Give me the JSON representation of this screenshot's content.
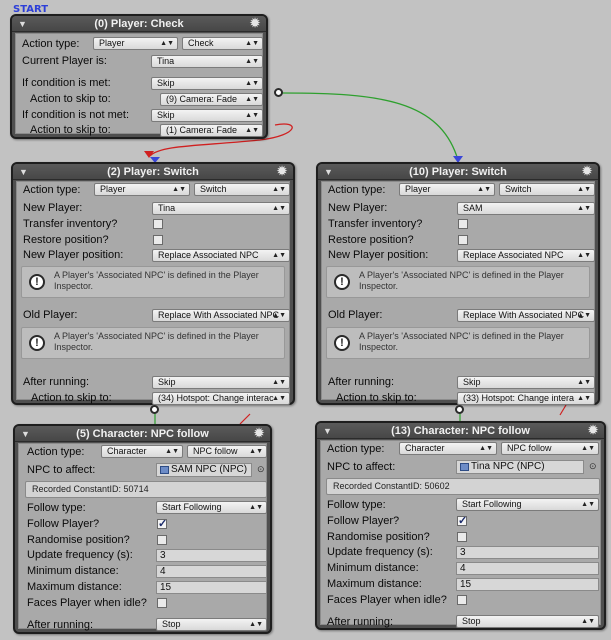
{
  "start_label": "START",
  "node0": {
    "title": "(0) Player: Check",
    "action_type_label": "Action type:",
    "action_type_value": "Player",
    "action_type_sub": "Check",
    "current_player_label": "Current Player is:",
    "current_player_value": "Tina",
    "if_met_label": "If condition is met:",
    "if_met_value": "Skip",
    "skip1_label": "Action to skip to:",
    "skip1_value": "(9) Camera: Fade",
    "if_not_met_label": "If condition is not met:",
    "if_not_met_value": "Skip",
    "skip2_label": "Action to skip to:",
    "skip2_value": "(1) Camera: Fade"
  },
  "node2": {
    "title": "(2) Player: Switch",
    "action_type_label": "Action type:",
    "action_type_value": "Player",
    "action_type_sub": "Switch",
    "new_player_label": "New Player:",
    "new_player_value": "Tina",
    "transfer_label": "Transfer inventory?",
    "restore_label": "Restore position?",
    "new_pos_label": "New Player position:",
    "new_pos_value": "Replace Associated NPC",
    "info1": "A Player's 'Associated NPC' is defined in the Player Inspector.",
    "old_player_label": "Old Player:",
    "old_player_value": "Replace With Associated NPC",
    "info2": "A Player's 'Associated NPC' is defined in the Player Inspector.",
    "after_label": "After running:",
    "after_value": "Skip",
    "skip_label": "Action to skip to:",
    "skip_value": "(34) Hotspot: Change interac"
  },
  "node10": {
    "title": "(10) Player: Switch",
    "action_type_label": "Action type:",
    "action_type_value": "Player",
    "action_type_sub": "Switch",
    "new_player_label": "New Player:",
    "new_player_value": "SAM",
    "transfer_label": "Transfer inventory?",
    "restore_label": "Restore position?",
    "new_pos_label": "New Player position:",
    "new_pos_value": "Replace Associated NPC",
    "info1": "A Player's 'Associated NPC' is defined in the Player Inspector.",
    "old_player_label": "Old Player:",
    "old_player_value": "Replace With Associated NPC",
    "info2": "A Player's 'Associated NPC' is defined in the Player Inspector.",
    "after_label": "After running:",
    "after_value": "Skip",
    "skip_label": "Action to skip to:",
    "skip_value": "(33) Hotspot: Change intera"
  },
  "node5": {
    "title": "(5) Character: NPC follow",
    "action_type_label": "Action type:",
    "action_type_value": "Character",
    "action_type_sub": "NPC follow",
    "npc_label": "NPC to affect:",
    "npc_value": "SAM NPC (NPC)",
    "recorded": "Recorded ConstantID: 50714",
    "follow_type_label": "Follow type:",
    "follow_type_value": "Start Following",
    "follow_player_label": "Follow Player?",
    "randomise_label": "Randomise position?",
    "update_label": "Update frequency (s):",
    "update_value": "3",
    "min_label": "Minimum distance:",
    "min_value": "4",
    "max_label": "Maximum distance:",
    "max_value": "15",
    "faces_label": "Faces Player when idle?",
    "after_label": "After running:",
    "after_value": "Stop"
  },
  "node13": {
    "title": "(13) Character: NPC follow",
    "action_type_label": "Action type:",
    "action_type_value": "Character",
    "action_type_sub": "NPC follow",
    "npc_label": "NPC to affect:",
    "npc_value": "Tina NPC (NPC)",
    "recorded": "Recorded ConstantID: 50602",
    "follow_type_label": "Follow type:",
    "follow_type_value": "Start Following",
    "follow_player_label": "Follow Player?",
    "randomise_label": "Randomise position?",
    "update_label": "Update frequency (s):",
    "update_value": "3",
    "min_label": "Minimum distance:",
    "min_value": "4",
    "max_label": "Maximum distance:",
    "max_value": "15",
    "faces_label": "Faces Player when idle?",
    "after_label": "After running:",
    "after_value": "Stop"
  }
}
